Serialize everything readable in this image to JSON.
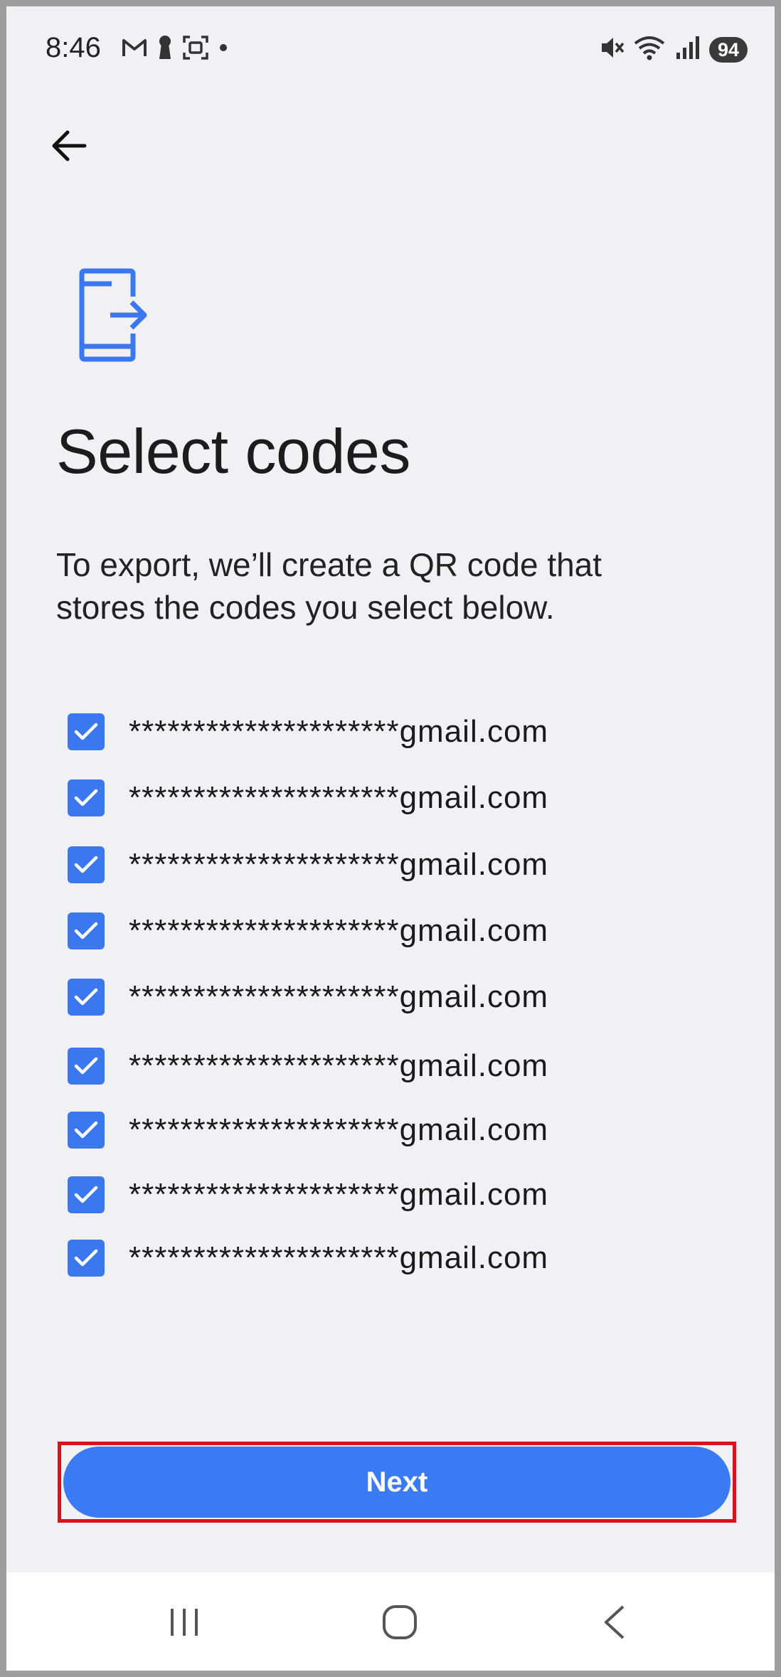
{
  "status_bar": {
    "time": "8:46",
    "battery": "94",
    "left_icons": [
      "gmail-icon",
      "keyhole-icon",
      "screenshot-icon",
      "dot-icon"
    ],
    "right_icons": [
      "mute-icon",
      "wifi-icon",
      "signal-icon"
    ]
  },
  "header": {
    "back_icon": "arrow-left-icon"
  },
  "main": {
    "icon": "export-phone-icon",
    "title": "Select codes",
    "description": "To export, we’ll create a QR code that stores the codes you select below.",
    "codes": [
      {
        "label": "*********************gmail.com",
        "checked": true
      },
      {
        "label": "*********************gmail.com",
        "checked": true
      },
      {
        "label": "*********************gmail.com",
        "checked": true
      },
      {
        "label": "*********************gmail.com",
        "checked": true
      },
      {
        "label": "*********************gmail.com",
        "checked": true
      },
      {
        "label": "*********************gmail.com",
        "checked": true
      },
      {
        "label": "*********************gmail.com",
        "checked": true
      },
      {
        "label": "*********************gmail.com",
        "checked": true
      },
      {
        "label": "*********************gmail.com",
        "checked": true
      }
    ]
  },
  "footer": {
    "next_label": "Next"
  },
  "nav_bar": {
    "items": [
      "recents-icon",
      "home-icon",
      "back-icon"
    ]
  },
  "colors": {
    "accent": "#3a7bf4",
    "checkbox": "#3b78f0",
    "background": "#f1f1f4",
    "highlight": "#e0101a"
  }
}
